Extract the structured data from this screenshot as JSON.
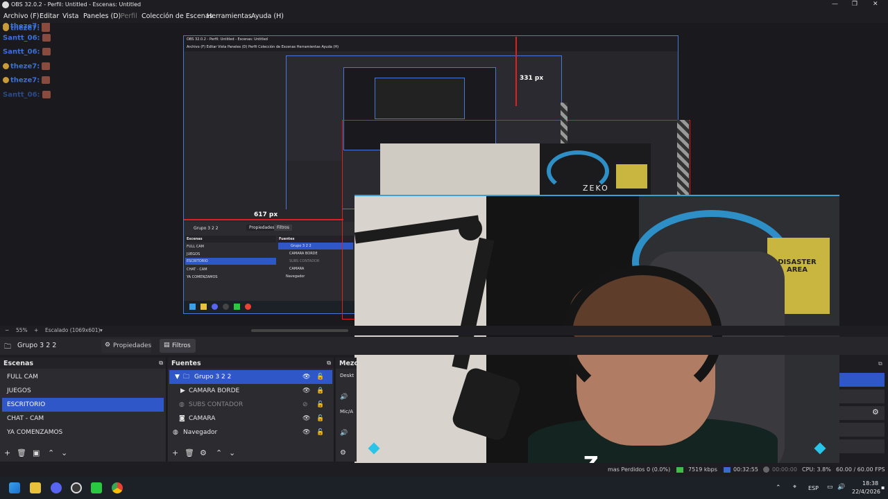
{
  "window": {
    "title": "OBS 32.0.2 - Perfil: Untitled - Escenas: Untitled",
    "minimize": "—",
    "maximize": "❐",
    "close": "✕"
  },
  "menu": [
    "Archivo (F)",
    "Editar",
    "Vista",
    "Paneles (D)",
    "Perfil",
    "Colección de Escenas",
    "Herramientas",
    "Ayuda (H)"
  ],
  "chat": [
    {
      "user": "theze7:",
      "color": "#3d6fd8",
      "badge": true
    },
    {
      "user": "theze7:",
      "color": "#3d6fd8",
      "badge": true
    },
    {
      "user": "Santt_06:",
      "color": "#3d6fd8",
      "badge": false
    },
    {
      "user": "Santt_06:",
      "color": "#3d6fd8",
      "badge": false
    },
    {
      "user": "theze7:",
      "color": "#3d6fd8",
      "badge": true
    },
    {
      "user": "theze7:",
      "color": "#3d6fd8",
      "badge": true
    },
    {
      "user": "Santt_06:",
      "color": "#2a4a8a",
      "badge": false
    }
  ],
  "preview": {
    "measure_h": "331 px",
    "measure_w": "617 px",
    "brand_text": "ZEKO",
    "sign_text": "DISASTER AREA",
    "nested_title": "OBS 32.0.2 - Perfil: Untitled - Escenas: Untitled",
    "nested_menu": "Archivo (F)   Editar   Vista   Paneles (D)   Perfil   Colección de Escenas   Herramientas   Ayuda (H)",
    "nested_tabs": {
      "scene": "Grupo 3 2 2",
      "props": "Propiedades",
      "filters": "Filtros"
    },
    "nested_scenes_hdr": "Escenas",
    "nested_sources_hdr": "Fuentes",
    "nested_scenes": [
      "FULL CAM",
      "JUEGOS",
      "ESCRITORIO",
      "CHAT - CAM",
      "YA COMENZAMOS"
    ],
    "nested_sources": [
      "Grupo 3 2 2",
      "CAMARA BORDE",
      "SUBS CONTADOR",
      "CAMARA",
      "Navegador"
    ]
  },
  "zoom": {
    "minus": "−",
    "percent": "55%",
    "plus": "+",
    "scale": "Escalado (1069x601)"
  },
  "context": {
    "scene": "Grupo 3 2 2",
    "properties": "Propiedades",
    "filters": "Filtros"
  },
  "scenes": {
    "title": "Escenas",
    "items": [
      "FULL CAM",
      "JUEGOS",
      "ESCRITORIO",
      "CHAT - CAM",
      "YA COMENZAMOS"
    ],
    "selected": 2
  },
  "sources": {
    "title": "Fuentes",
    "items": [
      {
        "name": "Grupo 3 2 2",
        "selected": true,
        "dim": false
      },
      {
        "name": "CAMARA BORDE",
        "selected": false,
        "dim": false
      },
      {
        "name": "SUBS CONTADOR",
        "selected": false,
        "dim": true
      },
      {
        "name": "CAMARA",
        "selected": false,
        "dim": false
      },
      {
        "name": "Navegador",
        "selected": false,
        "dim": false
      }
    ]
  },
  "mixer": {
    "title": "Mezc",
    "ch1": "Deskt",
    "ch2": "Mic/A"
  },
  "status": {
    "dropped": "mas Perdidos 0 (0.0%)",
    "bitrate": "7519 kbps",
    "live_time": "00:32:55",
    "rec_time": "00:00:00",
    "cpu": "CPU: 3.8%",
    "fps": "60.00 / 60.00 FPS"
  },
  "taskbar": {
    "lang": "ESP",
    "time": "18:38",
    "date": "22/4/2026"
  },
  "colors": {
    "accent": "#2f57c8",
    "red_guide": "#e0201e",
    "cam_blue": "#2e8fc6"
  }
}
